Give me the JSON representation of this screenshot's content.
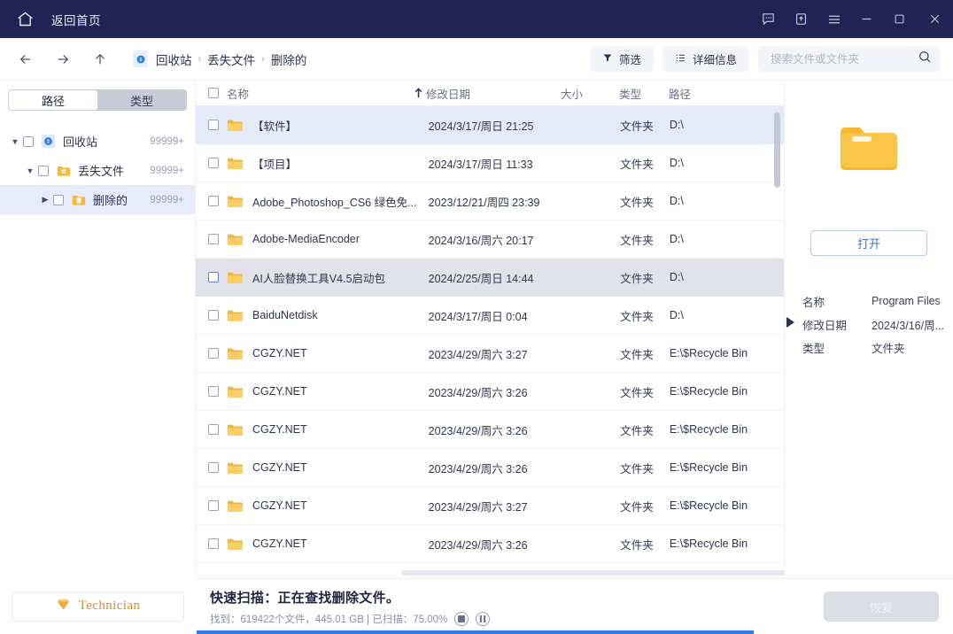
{
  "titlebar": {
    "home_icon": "home-icon",
    "home_label": "返回首页",
    "actions": [
      {
        "name": "feedback-icon",
        "glyph": "speech-bubble"
      },
      {
        "name": "upgrade-icon",
        "glyph": "upload-box"
      },
      {
        "name": "menu-icon",
        "glyph": "hamburger"
      },
      {
        "name": "minimize-icon",
        "glyph": "minus"
      },
      {
        "name": "maximize-icon",
        "glyph": "square"
      },
      {
        "name": "close-icon",
        "glyph": "cross"
      }
    ]
  },
  "toolbar": {
    "back_icon": "arrow-left-icon",
    "forward_icon": "arrow-right-icon",
    "up_icon": "arrow-up-icon",
    "breadcrumb": [
      "回收站",
      "丢失文件",
      "删除的"
    ],
    "breadcrumb_separator": "›",
    "filter_label": "筛选",
    "details_label": "详细信息",
    "search_value": "",
    "search_placeholder": "搜索文件或文件夹"
  },
  "sidebar": {
    "tabs": [
      {
        "label": "路径",
        "active": true
      },
      {
        "label": "类型",
        "active": false
      }
    ],
    "tree": [
      {
        "label": "回收站",
        "count": "99999+",
        "indent": 0,
        "arrow": "▼",
        "icon": "recycle-bin-icon",
        "selected": false
      },
      {
        "label": "丢失文件",
        "count": "99999+",
        "indent": 1,
        "arrow": "▼",
        "icon": "lost-folder-icon",
        "selected": false
      },
      {
        "label": "删除的",
        "count": "99999+",
        "indent": 2,
        "arrow": "▶",
        "icon": "deleted-folder-icon",
        "selected": true
      }
    ],
    "technician_label": "Technician",
    "technician_icon": "gem-icon"
  },
  "filelist": {
    "columns": {
      "name": "名称",
      "date": "修改日期",
      "size": "大小",
      "type": "类型",
      "path": "路径"
    },
    "sort_icon": "sort-ascending-icon",
    "rows": [
      {
        "name": "【软件】",
        "date": "2024/3/17/周日 21:25",
        "size": "",
        "type": "文件夹",
        "path": "D:\\",
        "state": "selected"
      },
      {
        "name": "【项目】",
        "date": "2024/3/17/周日 11:33",
        "size": "",
        "type": "文件夹",
        "path": "D:\\",
        "state": ""
      },
      {
        "name": "Adobe_Photoshop_CS6 绿色免...",
        "date": "2023/12/21/周四 23:39",
        "size": "",
        "type": "文件夹",
        "path": "D:\\",
        "state": ""
      },
      {
        "name": "Adobe-MediaEncoder",
        "date": "2024/3/16/周六 20:17",
        "size": "",
        "type": "文件夹",
        "path": "D:\\",
        "state": ""
      },
      {
        "name": "AI人脸替换工具V4.5启动包",
        "date": "2024/2/25/周日 14:44",
        "size": "",
        "type": "文件夹",
        "path": "D:\\",
        "state": "hover"
      },
      {
        "name": "BaiduNetdisk",
        "date": "2024/3/17/周日 0:04",
        "size": "",
        "type": "文件夹",
        "path": "D:\\",
        "state": ""
      },
      {
        "name": "CGZY.NET",
        "date": "2023/4/29/周六 3:27",
        "size": "",
        "type": "文件夹",
        "path": "E:\\$Recycle Bin",
        "state": ""
      },
      {
        "name": "CGZY.NET",
        "date": "2023/4/29/周六 3:26",
        "size": "",
        "type": "文件夹",
        "path": "E:\\$Recycle Bin",
        "state": ""
      },
      {
        "name": "CGZY.NET",
        "date": "2023/4/29/周六 3:26",
        "size": "",
        "type": "文件夹",
        "path": "E:\\$Recycle Bin",
        "state": ""
      },
      {
        "name": "CGZY.NET",
        "date": "2023/4/29/周六 3:26",
        "size": "",
        "type": "文件夹",
        "path": "E:\\$Recycle Bin",
        "state": ""
      },
      {
        "name": "CGZY.NET",
        "date": "2023/4/29/周六 3:27",
        "size": "",
        "type": "文件夹",
        "path": "E:\\$Recycle Bin",
        "state": ""
      },
      {
        "name": "CGZY.NET",
        "date": "2023/4/29/周六 3:26",
        "size": "",
        "type": "文件夹",
        "path": "E:\\$Recycle Bin",
        "state": ""
      }
    ]
  },
  "preview": {
    "folder_icon": "large-folder-icon",
    "open_label": "打开",
    "meta": [
      {
        "key": "名称",
        "value": "Program Files"
      },
      {
        "key": "修改日期",
        "value": "2024/3/16/周..."
      },
      {
        "key": "类型",
        "value": "文件夹"
      }
    ]
  },
  "status": {
    "title": "快速扫描：正在查找删除文件。",
    "detail": "找到：619422个文件，445.01 GB | 已扫描：75.00%",
    "stop_icon": "stop-icon",
    "pause_icon": "pause-icon",
    "recover_label": "恢复",
    "progress_percent": 75
  },
  "colors": {
    "titlebar": "#1f2454",
    "accent_blue": "#2f7fe0",
    "selection": "#e4eaf8",
    "folder_yellow": "#f6c košt"
  }
}
